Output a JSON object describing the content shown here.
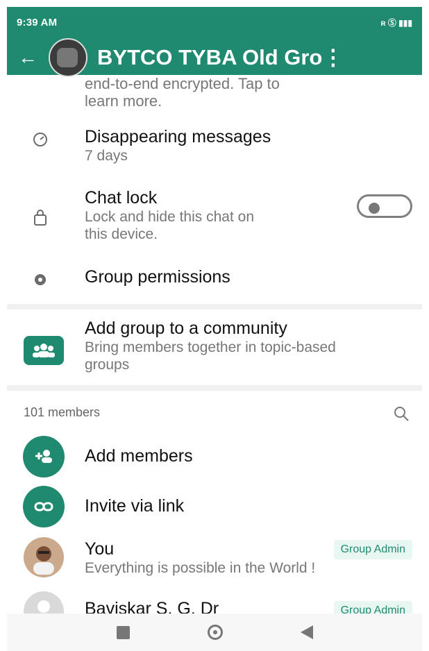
{
  "status_bar": {
    "time": "9:39 AM",
    "status_icons_right": "ʀ Ⓢ ▮▮▮"
  },
  "appbar": {
    "title": "BYTCO TYBA Old Gro⋮"
  },
  "encryption": {
    "text_line_1": "end-to-end encrypted. Tap to",
    "text_line_2": "learn more."
  },
  "settings": [
    {
      "title": "Disappearing messages",
      "subtitle": "7 days",
      "icon": "timer-icon"
    },
    {
      "title": "Chat lock",
      "subtitle_line_1": "Lock and hide this chat on",
      "subtitle_line_2": "this device.",
      "icon": "lock-icon"
    },
    {
      "title": "Group permissions",
      "icon": "gear-icon"
    }
  ],
  "community": {
    "title": "Add group to a community",
    "subtitle_line_1": "Bring members together in topic-based",
    "subtitle_line_2": "groups",
    "icon": "community-icon"
  },
  "members": {
    "count_label": "101 members",
    "actions": [
      {
        "label": "Add members",
        "icon": "add-person-icon"
      },
      {
        "label": "Invite via link",
        "icon": "link-icon"
      }
    ],
    "list": [
      {
        "name": "You",
        "status": "Everything is possible in the World !",
        "badge": "Group Admin"
      },
      {
        "name": "Baviskar S. G. Dr",
        "status": "",
        "badge": "Group Admin"
      }
    ]
  },
  "colors": {
    "header": "#1f8a6f",
    "accent": "#1f8a6f",
    "badge_bg": "#e8f7f1"
  }
}
